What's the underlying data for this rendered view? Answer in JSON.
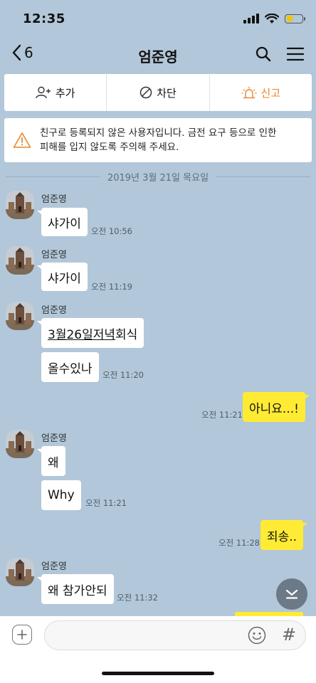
{
  "status": {
    "time": "12:35"
  },
  "header": {
    "back_count": "6",
    "title": "엄준영"
  },
  "actions": {
    "add": "추가",
    "block": "차단",
    "report": "신고"
  },
  "colors": {
    "background": "#b2c7d9",
    "my_bubble": "#ffeb33",
    "report": "#e8862a"
  },
  "warning": {
    "line1": "친구로 등록되지 않은 사용자입니다. 금전 요구 등으로 인한",
    "line2": "피해를 입지 않도록 주의해 주세요."
  },
  "date_separator": "2019년 3월 21일 목요일",
  "sender_name": "엄준영",
  "messages": [
    {
      "text": "샤가이",
      "time": "오전 10:56"
    },
    {
      "text": "샤가이",
      "time": "오전 11:19"
    },
    {
      "text_underlined": "3월26일저녁",
      "text_rest": "회식"
    },
    {
      "text": "올수있나",
      "time": "오전 11:20"
    },
    {
      "text": "아니요...!",
      "time": "오전 11:21"
    },
    {
      "text": "왜"
    },
    {
      "text": "Why",
      "time": "오전 11:21"
    },
    {
      "text": "죄송..",
      "time": "오전 11:28"
    },
    {
      "text": "왜 참가안되",
      "time": "오전 11:32"
    }
  ],
  "icons": [
    "back-chevron-icon",
    "search-icon",
    "menu-icon",
    "add-friend-icon",
    "block-icon",
    "siren-icon",
    "warning-icon",
    "scroll-down-icon",
    "plus-icon",
    "emoji-icon"
  ],
  "input": {
    "hash_label": "#"
  }
}
